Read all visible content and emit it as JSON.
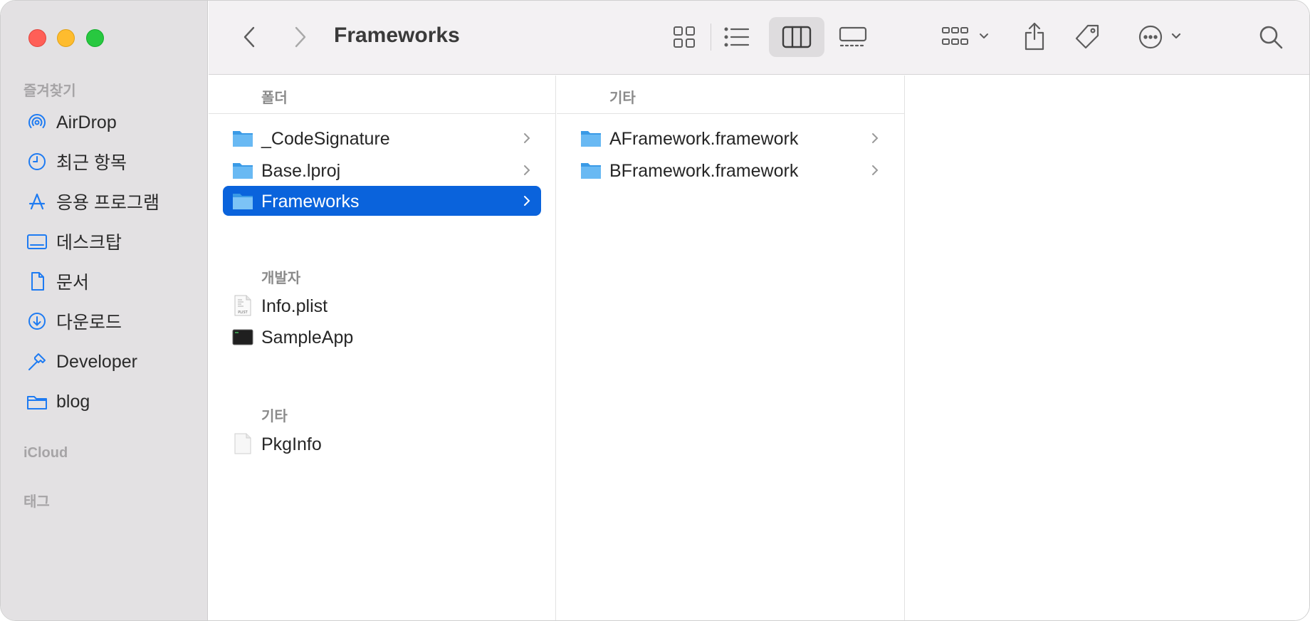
{
  "window": {
    "title": "Frameworks"
  },
  "sidebar": {
    "favorites_header": "즐겨찾기",
    "items": [
      {
        "label": "AirDrop",
        "icon": "airdrop-icon"
      },
      {
        "label": "최근 항목",
        "icon": "clock-icon"
      },
      {
        "label": "응용 프로그램",
        "icon": "applications-icon"
      },
      {
        "label": "데스크탑",
        "icon": "desktop-icon"
      },
      {
        "label": "문서",
        "icon": "document-icon"
      },
      {
        "label": "다운로드",
        "icon": "download-icon"
      },
      {
        "label": "Developer",
        "icon": "hammer-icon"
      },
      {
        "label": "blog",
        "icon": "folder-icon"
      }
    ],
    "icloud_header": "iCloud",
    "tags_header": "태그"
  },
  "toolbar": {
    "back": "chevron-left-icon",
    "forward": "chevron-right-icon",
    "view_modes": [
      "icon-view-icon",
      "list-view-icon",
      "column-view-icon",
      "gallery-view-icon"
    ],
    "active_view": "column",
    "group": "group-icon",
    "share": "share-icon",
    "tag": "tag-icon",
    "more": "more-icon",
    "search": "search-icon"
  },
  "column1": {
    "header": "폴더",
    "folders": [
      {
        "name": "_CodeSignature"
      },
      {
        "name": "Base.lproj"
      },
      {
        "name": "Frameworks",
        "selected": true
      }
    ],
    "developer_header": "개발자",
    "developer_files": [
      {
        "name": "Info.plist",
        "icon": "plist-file-icon"
      },
      {
        "name": "SampleApp",
        "icon": "executable-icon"
      }
    ],
    "other_header": "기타",
    "other_files": [
      {
        "name": "PkgInfo",
        "icon": "blank-file-icon"
      }
    ]
  },
  "column2": {
    "header": "기타",
    "items": [
      {
        "name": "AFramework.framework"
      },
      {
        "name": "BFramework.framework"
      }
    ]
  },
  "colors": {
    "selection": "#0a63dc",
    "accent_icon": "#1e7bf2",
    "sidebar_bg": "#e3e1e3"
  }
}
